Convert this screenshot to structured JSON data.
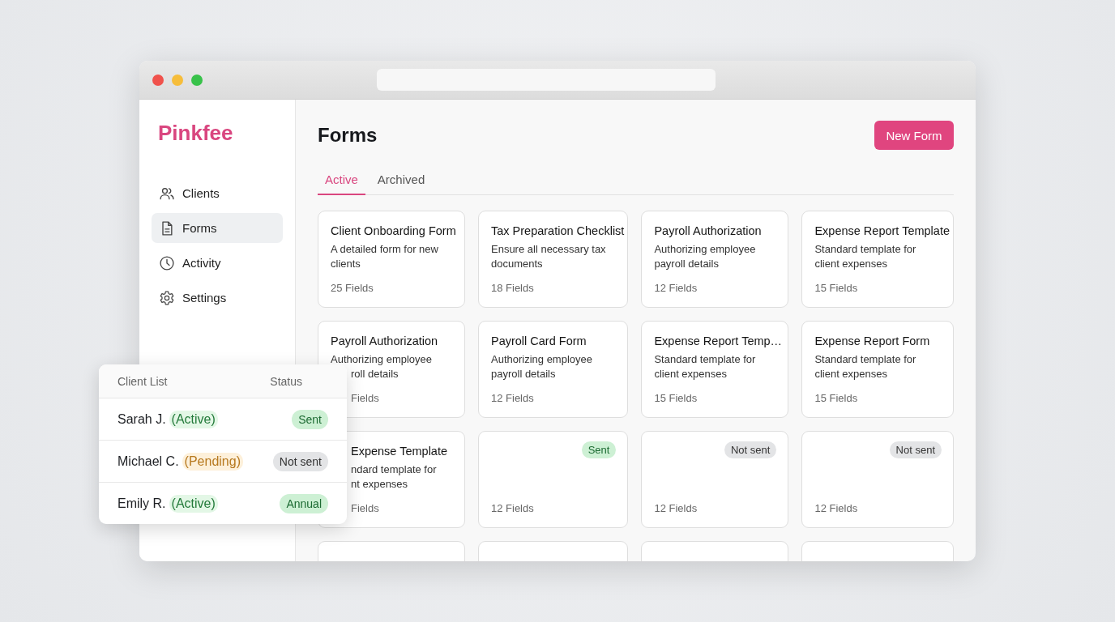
{
  "sidebar": {
    "logo": "Pinkfee",
    "items": [
      {
        "label": "Clients",
        "selected": false
      },
      {
        "label": "Forms",
        "selected": true
      },
      {
        "label": "Activity",
        "selected": false
      },
      {
        "label": "Settings",
        "selected": false
      }
    ]
  },
  "header": {
    "title": "Forms",
    "new_button": "New Form"
  },
  "tabs": [
    {
      "label": "Active",
      "selected": true
    },
    {
      "label": "Archived",
      "selected": false
    }
  ],
  "cards": [
    {
      "title": {
        "text": "Client Onboarding Form",
        "clipped": false
      },
      "description": [
        {
          "text": "A detailed form for new clients",
          "clipped": false
        }
      ],
      "fields": {
        "text": "25 Fields",
        "clipped": false
      }
    },
    {
      "title": {
        "text": "Tax Preparation Checklist",
        "clipped": false
      },
      "description": [
        {
          "text": "Ensure all necessary tax documents",
          "clipped": false
        }
      ],
      "fields": {
        "text": "18 Fields",
        "clipped": false
      }
    },
    {
      "title": {
        "text": "Payroll Authorization",
        "clipped": false
      },
      "description": [
        {
          "text": "Authorizing employee payroll details",
          "clipped": false
        }
      ],
      "fields": {
        "text": "12 Fields",
        "clipped": false
      }
    },
    {
      "title": {
        "text": "Expense Report Template",
        "clipped": false
      },
      "description": [
        {
          "text": "Standard template for client expenses",
          "clipped": false
        }
      ],
      "fields": {
        "text": "15 Fields",
        "clipped": false
      }
    },
    {
      "title": {
        "text": "Payroll Authorization",
        "clipped": false
      },
      "description": [
        {
          "text": "Authorizing employee",
          "clipped": false
        },
        {
          "text": "roll details",
          "clipped": true
        }
      ],
      "fields": {
        "text": "Fields",
        "clipped": true
      }
    },
    {
      "title": {
        "text": "Payroll Card Form",
        "clipped": false
      },
      "description": [
        {
          "text": "Authorizing employee payroll details",
          "clipped": false
        }
      ],
      "fields": {
        "text": "12 Fields",
        "clipped": false
      }
    },
    {
      "title": {
        "text": "Expense Report Temp…",
        "clipped": false
      },
      "description": [
        {
          "text": "Standard template for client expenses",
          "clipped": false
        }
      ],
      "fields": {
        "text": "15 Fields",
        "clipped": false
      }
    },
    {
      "title": {
        "text": "Expense Report Form",
        "clipped": false
      },
      "description": [
        {
          "text": "Standard template for client expenses",
          "clipped": false
        }
      ],
      "fields": {
        "text": "15 Fields",
        "clipped": false
      }
    },
    {
      "title": {
        "text": "Expense Template",
        "clipped": true
      },
      "description": [
        {
          "text": "ndard template for",
          "clipped": true
        },
        {
          "text": "nt expenses",
          "clipped": true
        }
      ],
      "fields": {
        "text": "Fields",
        "clipped": true
      }
    },
    {
      "badge": {
        "text": "Sent",
        "kind": "sent"
      },
      "fields": {
        "text": "12 Fields",
        "clipped": false
      }
    },
    {
      "badge": {
        "text": "Not sent",
        "kind": "not_sent"
      },
      "fields": {
        "text": "12 Fields",
        "clipped": false
      }
    },
    {
      "badge": {
        "text": "Not sent",
        "kind": "not_sent"
      },
      "fields": {
        "text": "12 Fields",
        "clipped": false
      }
    }
  ],
  "client_list": {
    "headers": [
      "Client List",
      "Status"
    ],
    "rows": [
      {
        "name": "Sarah J.",
        "tag": {
          "text": "(Active)",
          "kind": "active"
        },
        "status": {
          "text": "Sent",
          "kind": "sent"
        }
      },
      {
        "name": "Michael C.",
        "tag": {
          "text": "(Pending)",
          "kind": "pending"
        },
        "status": {
          "text": "Not sent",
          "kind": "not_sent"
        }
      },
      {
        "name": "Emily R.",
        "tag": {
          "text": "(Active)",
          "kind": "active"
        },
        "status": {
          "text": "Annual",
          "kind": "sent"
        }
      }
    ]
  }
}
